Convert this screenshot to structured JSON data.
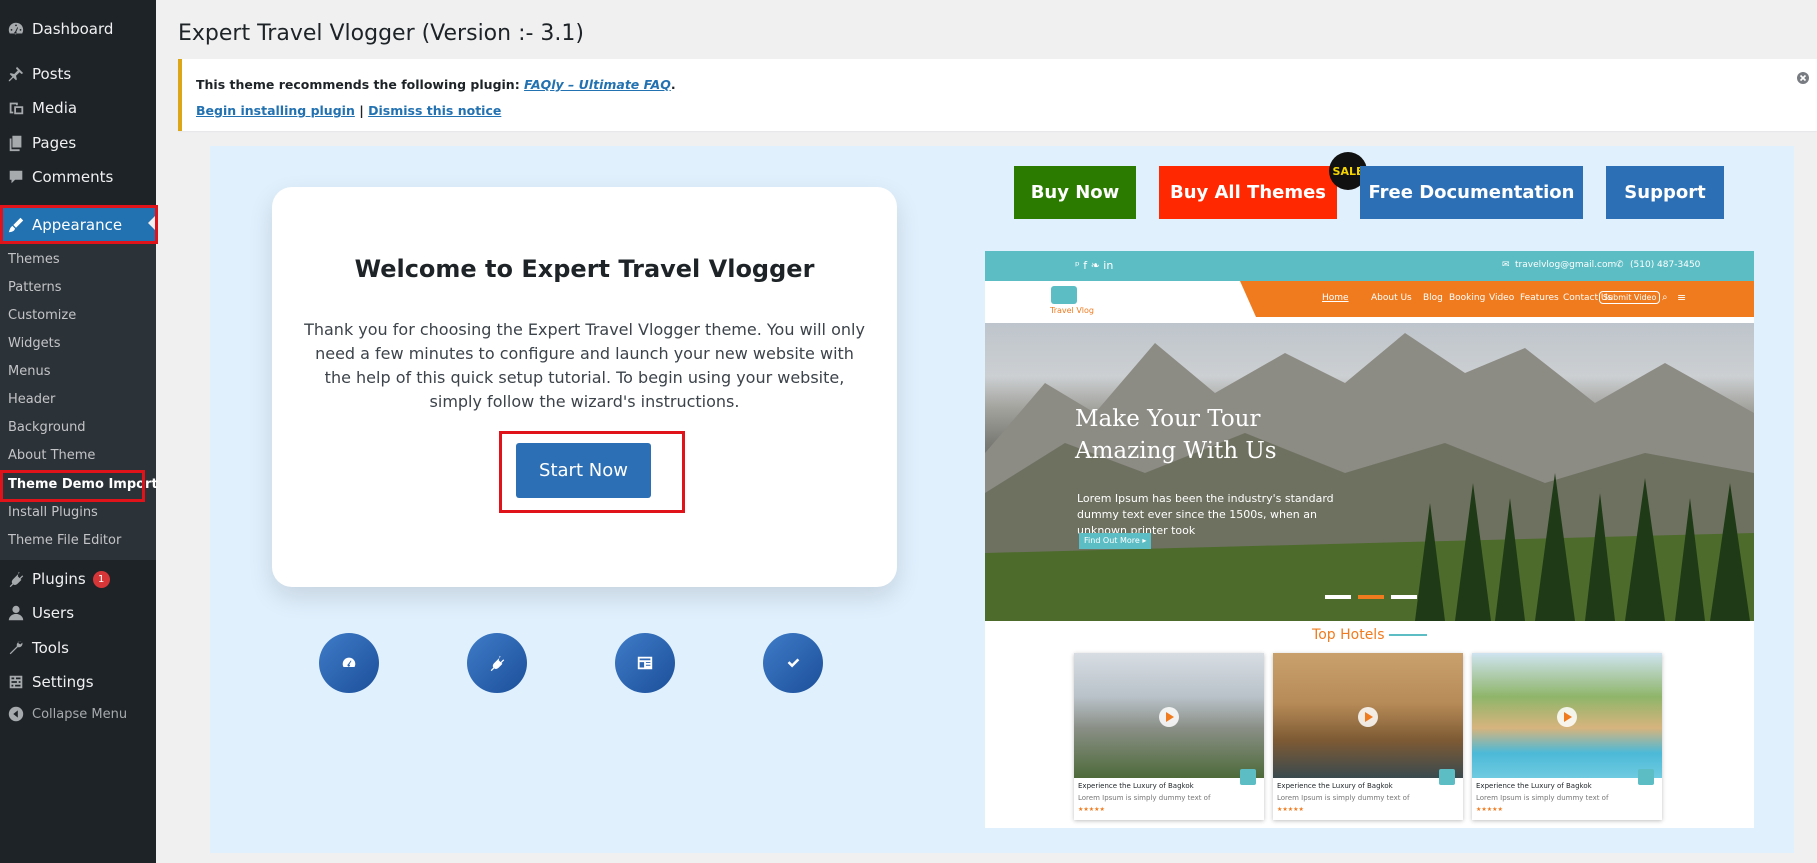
{
  "sidebar": {
    "items": [
      {
        "label": "Dashboard",
        "icon": "dashboard-icon"
      },
      {
        "label": "Posts",
        "icon": "pin-icon"
      },
      {
        "label": "Media",
        "icon": "media-icon"
      },
      {
        "label": "Pages",
        "icon": "pages-icon"
      },
      {
        "label": "Comments",
        "icon": "comments-icon"
      },
      {
        "label": "Appearance",
        "icon": "brush-icon"
      },
      {
        "label": "Plugins",
        "icon": "plugin-icon",
        "badge": "1"
      },
      {
        "label": "Users",
        "icon": "user-icon"
      },
      {
        "label": "Tools",
        "icon": "wrench-icon"
      },
      {
        "label": "Settings",
        "icon": "settings-icon"
      },
      {
        "label": "Collapse Menu",
        "icon": "collapse-icon"
      }
    ],
    "submenu": [
      "Themes",
      "Patterns",
      "Customize",
      "Widgets",
      "Menus",
      "Header",
      "Background",
      "About Theme",
      "Theme Demo Import",
      "Install Plugins",
      "Theme File Editor"
    ]
  },
  "header": {
    "title": "Expert Travel Vlogger (Version :- 3.1)"
  },
  "notice": {
    "prefix": "This theme recommends the following plugin: ",
    "plugin_link": "FAQly – Ultimate FAQ",
    "suffix": ".",
    "install_link": "Begin installing plugin",
    "separator": " | ",
    "dismiss_link": "Dismiss this notice"
  },
  "wizard": {
    "title": "Welcome to Expert Travel Vlogger",
    "description": "Thank you for choosing the Expert Travel Vlogger theme. You will only need a few minutes to configure and launch your new website with the help of this quick setup tutorial. To begin using your website, simply follow the wizard's instructions.",
    "start_button": "Start Now",
    "steps": [
      "dashboard-icon",
      "plugin-icon",
      "layout-icon",
      "check-icon"
    ]
  },
  "actions": {
    "buy_now": "Buy Now",
    "buy_all": "Buy All Themes",
    "sale": "SALE",
    "docs": "Free Documentation",
    "support": "Support"
  },
  "colors": {
    "admin_bg": "#1d2327",
    "accent": "#2271b1",
    "highlight": "#e0131a",
    "buy_now": "#2a7b00",
    "buy_all": "#ff2800",
    "docs": "#2d6fb5"
  },
  "preview": {
    "email": "travelvlog@gmail.com",
    "phone": "(510) 487-3450",
    "logo": "Travel Vlog",
    "nav": [
      "Home",
      "About Us",
      "Blog",
      "Booking",
      "Video",
      "Features",
      "Contact Us"
    ],
    "submit": "Submit Video",
    "hero_title_1": "Make Your Tour",
    "hero_title_2": "Amazing With Us",
    "hero_text": "Lorem Ipsum has been the industry's standard dummy text ever since the 1500s, when an unknown printer took",
    "hero_button": "Find Out More ▸",
    "hotels_title": "Top Hotels",
    "hotels": [
      {
        "title": "Experience the Luxury of Bagkok",
        "desc": "Lorem Ipsum is simply dummy text of",
        "rating": "★★★★★"
      },
      {
        "title": "Experience the Luxury of Bagkok",
        "desc": "Lorem Ipsum is simply dummy text of",
        "rating": "★★★★★"
      },
      {
        "title": "Experience the Luxury of Bagkok",
        "desc": "Lorem Ipsum is simply dummy text of",
        "rating": "★★★★★"
      }
    ]
  }
}
